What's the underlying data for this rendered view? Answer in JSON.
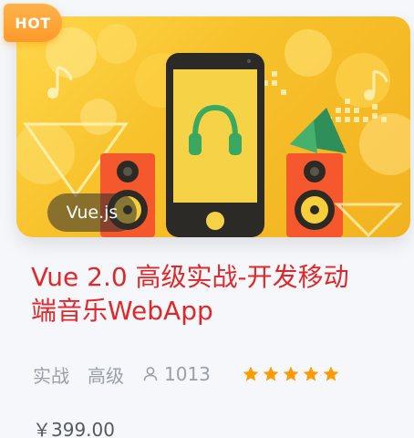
{
  "badge": {
    "hot": "HOT"
  },
  "banner": {
    "tag": "Vue.js"
  },
  "course": {
    "title_line1": "Vue 2.0 高级实战-开发移动",
    "title_line2": "端音乐WebApp",
    "type": "实战",
    "level": "高级",
    "students": "1013",
    "rating_stars": 5,
    "price": "￥399.00"
  },
  "colors": {
    "title": "#e0282a",
    "badge": "#ff9a2a",
    "star": "#ff9a00",
    "meta": "#9aa0a6"
  }
}
